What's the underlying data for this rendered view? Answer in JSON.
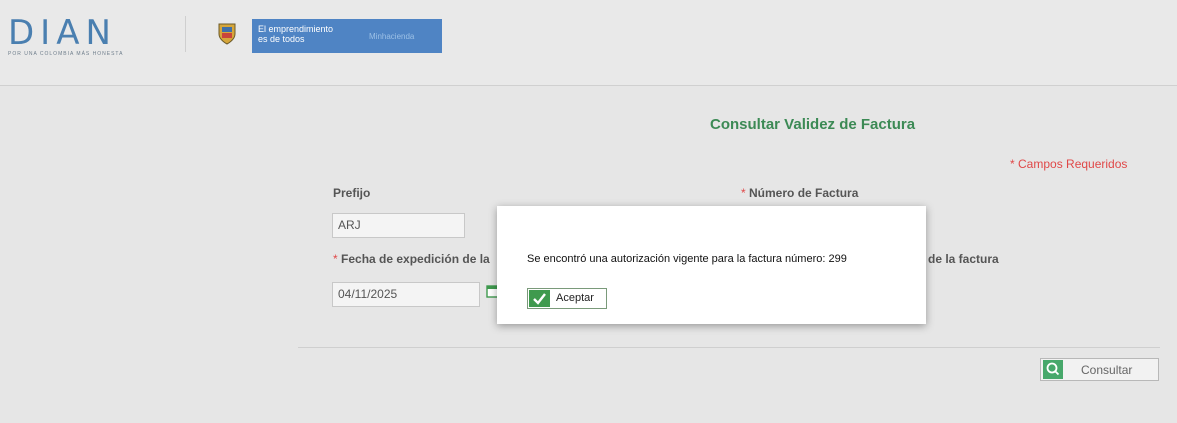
{
  "header": {
    "logo_text": "DIAN",
    "logo_tagline": "POR UNA COLOMBIA MÁS HONESTA",
    "gov_slogan_line1": "El emprendimiento",
    "gov_slogan_line2": "es de todos",
    "gov_ministry": "Minhacienda"
  },
  "form": {
    "title": "Consultar Validez de Factura",
    "required_note": "* Campos Requeridos",
    "prefijo_label": "Prefijo",
    "prefijo_value": "ARJ",
    "numero_label": "Número de Factura",
    "fecha_label": "Fecha de expedición de la",
    "fecha_value": "04/11/2025",
    "right_partial_label": "de la factura",
    "required_marker": "*",
    "consult_label": "Consultar"
  },
  "modal": {
    "message": "Se encontró una autorización vigente para la factura número: 299",
    "accept_label": "Aceptar"
  },
  "colors": {
    "accent_green": "#3c8a55",
    "required_red": "#e04848",
    "gov_blue": "#4f84c4"
  },
  "icons": {
    "calendar": "calendar-icon",
    "search": "search-icon",
    "check": "check-icon",
    "shield": "coat-of-arms-icon"
  }
}
